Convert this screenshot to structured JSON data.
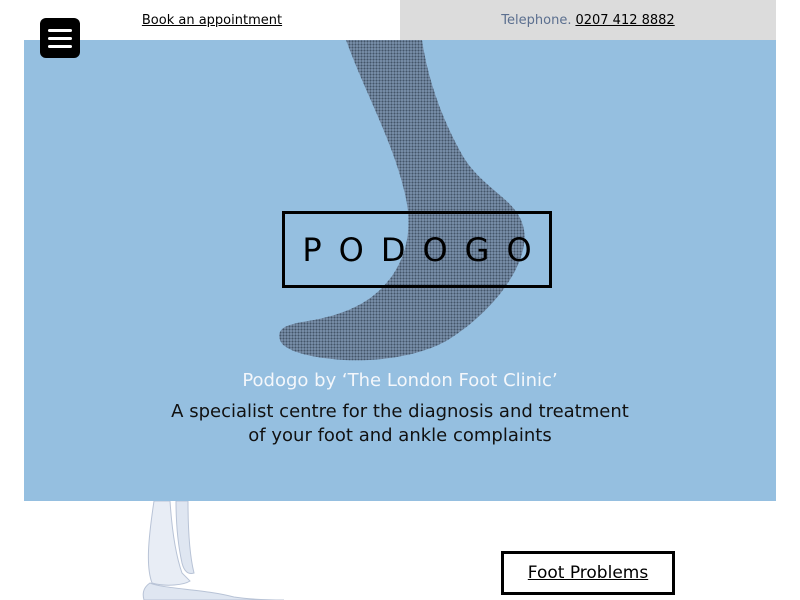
{
  "topbar": {
    "book_label": "Book an appointment",
    "telephone_label": "Telephone.",
    "telephone_number": "0207 412 8882"
  },
  "menu": {
    "icon": "hamburger-menu-icon"
  },
  "hero": {
    "logo": "PODOGO",
    "subtitle": "Podogo by ‘The London Foot Clinic’",
    "description_line1": "A specialist centre for the diagnosis and treatment",
    "description_line2": "of your foot and ankle complaints",
    "background_color": "#95bfe0"
  },
  "sections": {
    "foot_problems_label": "Foot Problems"
  }
}
